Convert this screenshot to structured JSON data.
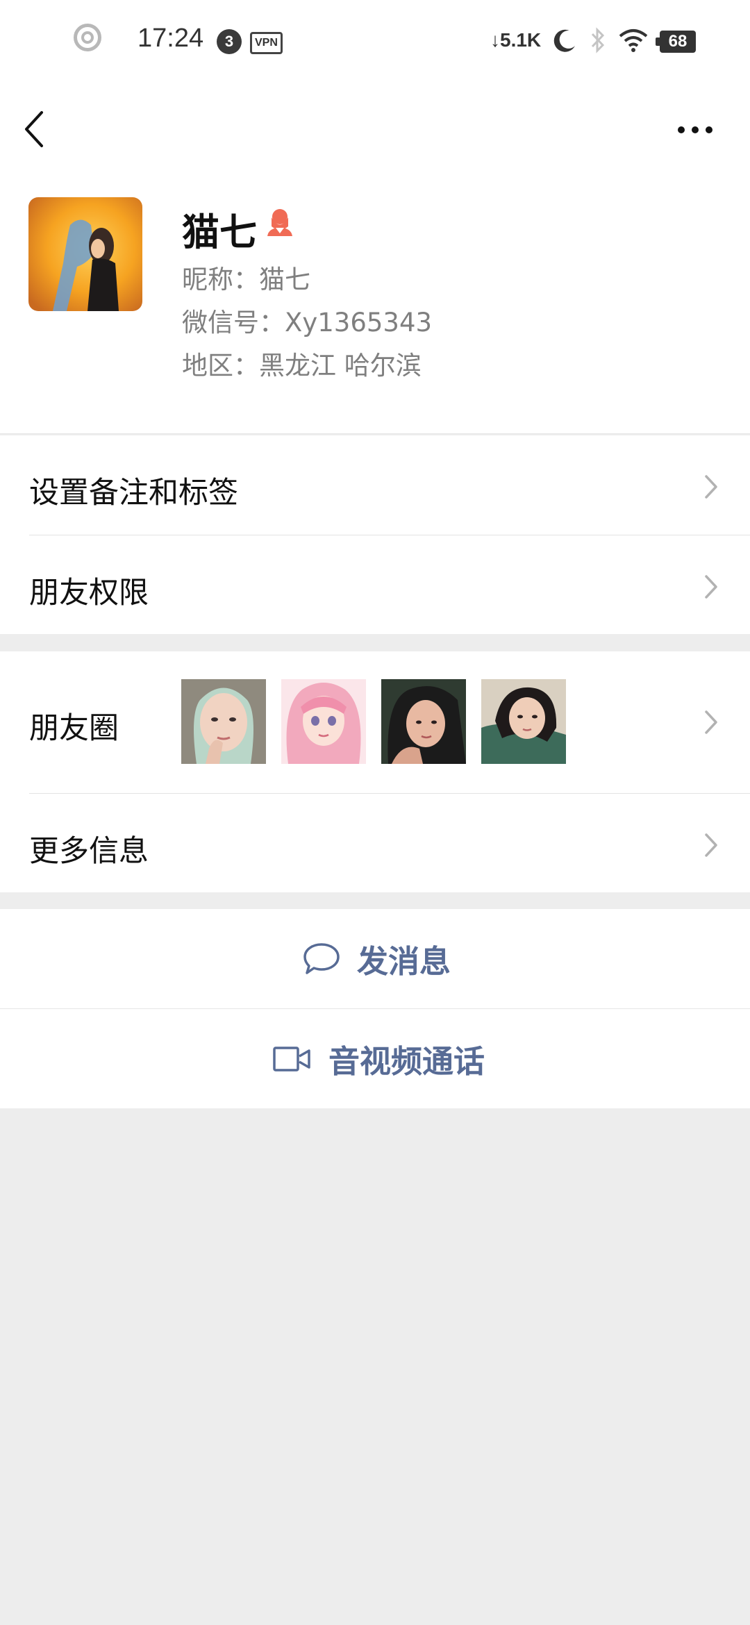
{
  "status_bar": {
    "time": "17:24",
    "notification_count": "3",
    "vpn_label": "VPN",
    "net_speed": "5.1K",
    "battery": "68"
  },
  "profile": {
    "name": "猫七",
    "nickname": "昵称：猫七",
    "wechat_id": "微信号：Xy1365343",
    "region": "地区：黑龙江  哈尔滨",
    "gender_icon_color": "#f06b55"
  },
  "menu": {
    "remark_tags": "设置备注和标签",
    "permissions": "朋友权限",
    "moments": "朋友圈",
    "more_info": "更多信息"
  },
  "actions": {
    "send_message": "发消息",
    "video_call": "音视频通话",
    "accent_color": "#576b95"
  }
}
